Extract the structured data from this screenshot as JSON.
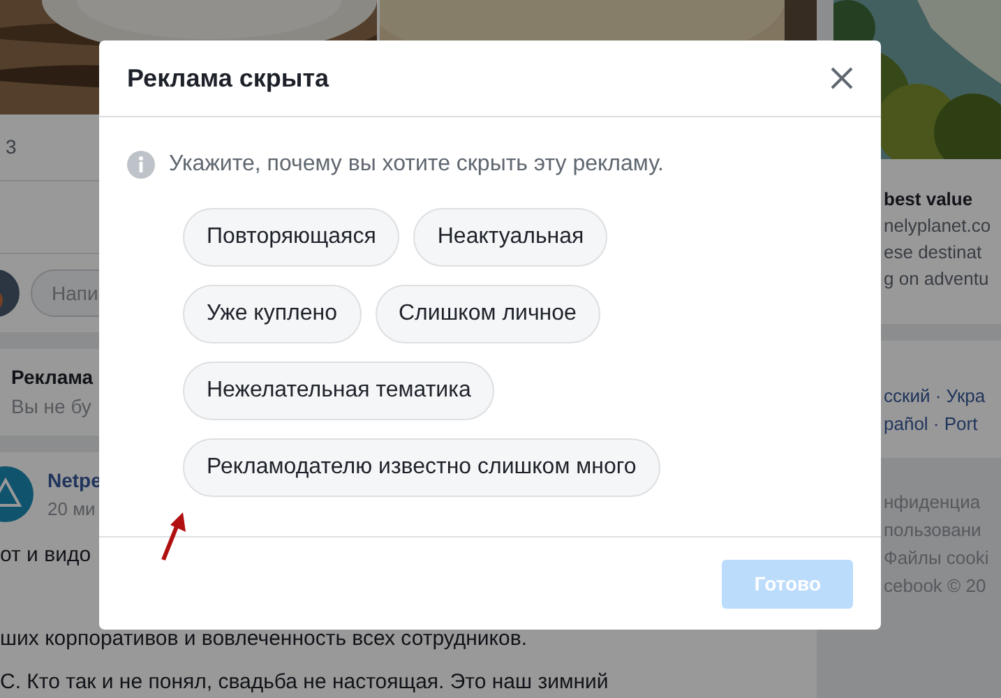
{
  "background": {
    "feed": {
      "post_stat": "3",
      "comment_placeholder": "Напи",
      "ad_notice": {
        "title": "Реклама",
        "text": "Вы не бу"
      },
      "post": {
        "author": "Netpe",
        "time": "20 ми",
        "lines": [
          "от и видо",
          "ших корпоративов и вовлеченность всех сотрудников.",
          "С. Кто так и не понял, свадьба не настоящая. Это наш зимний"
        ]
      }
    },
    "sidebar": {
      "ad": {
        "title": "best value",
        "domain": "nelyplanet.co",
        "lines": [
          "ese destinat",
          "g on adventu"
        ]
      },
      "languages": [
        "сский · Укра",
        "pañol · Port"
      ],
      "footer": [
        "нфиденциа",
        "пользовани",
        "Файлы cooki",
        "cebook © 20"
      ]
    }
  },
  "dialog": {
    "title": "Реклама скрыта",
    "prompt": "Укажите, почему вы хотите скрыть эту рекламу.",
    "reasons": [
      {
        "label": "Повторяющаяся",
        "selected": false
      },
      {
        "label": "Неактуальная",
        "selected": false
      },
      {
        "label": "Уже куплено",
        "selected": false
      },
      {
        "label": "Слишком личное",
        "selected": false
      },
      {
        "label": "Нежелательная тематика",
        "selected": false
      },
      {
        "label": "Рекламодателю известно слишком много",
        "selected": false
      }
    ],
    "done_button": {
      "label": "Готово",
      "disabled": true
    }
  }
}
